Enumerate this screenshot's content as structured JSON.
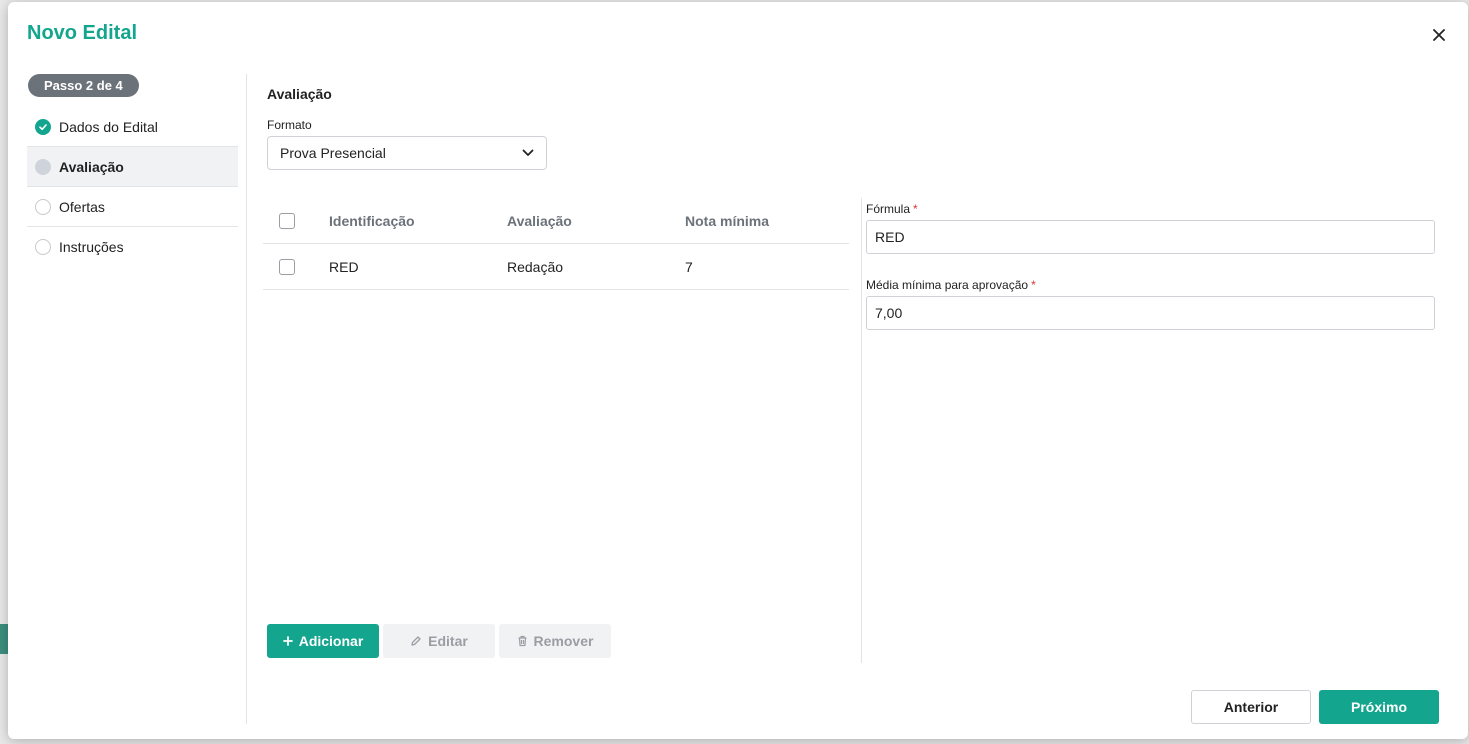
{
  "modal": {
    "title": "Novo Edital",
    "close_icon": "close-icon"
  },
  "sidebar": {
    "step_badge": "Passo 2 de 4",
    "steps": [
      {
        "label": "Dados do Edital",
        "state": "done"
      },
      {
        "label": "Avaliação",
        "state": "current"
      },
      {
        "label": "Ofertas",
        "state": "todo"
      },
      {
        "label": "Instruções",
        "state": "todo"
      }
    ]
  },
  "main": {
    "section_title": "Avaliação",
    "format_label": "Formato",
    "format_value": "Prova Presencial",
    "table": {
      "columns": [
        "Identificação",
        "Avaliação",
        "Nota mínima"
      ],
      "rows": [
        {
          "id": "RED",
          "evaluation": "Redação",
          "min_grade": "7"
        }
      ]
    },
    "formula": {
      "label": "Fórmula",
      "required_mark": "*",
      "value": "RED"
    },
    "min_average": {
      "label": "Média mínima para aprovação",
      "required_mark": "*",
      "value": "7,00"
    },
    "actions": {
      "add": "Adicionar",
      "edit": "Editar",
      "remove": "Remover"
    }
  },
  "footer": {
    "previous": "Anterior",
    "next": "Próximo"
  },
  "colors": {
    "accent": "#14a58e",
    "badge": "#6c727a",
    "required": "#d9342b"
  }
}
